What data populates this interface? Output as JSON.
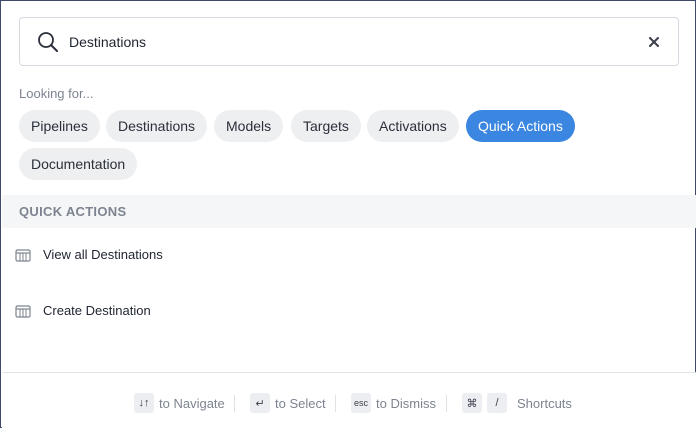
{
  "search": {
    "value": "Destinations",
    "icon": "search-icon",
    "clear_icon": "close-icon"
  },
  "looking_for": {
    "label": "Looking for...",
    "chips": [
      {
        "label": "Pipelines",
        "active": false
      },
      {
        "label": "Destinations",
        "active": false
      },
      {
        "label": "Models",
        "active": false
      },
      {
        "label": "Targets",
        "active": false
      },
      {
        "label": "Activations",
        "active": false
      },
      {
        "label": "Quick Actions",
        "active": true
      },
      {
        "label": "Documentation",
        "active": false
      }
    ]
  },
  "section": {
    "title": "QUICK ACTIONS",
    "items": [
      {
        "label": "View all Destinations",
        "icon": "destination-icon"
      },
      {
        "label": "Create Destination",
        "icon": "destination-icon"
      }
    ]
  },
  "footer": {
    "navigate": {
      "key": "↓↑",
      "label": "to Navigate"
    },
    "select": {
      "key": "↵",
      "label": "to Select"
    },
    "dismiss": {
      "key": "esc",
      "label": "to Dismiss"
    },
    "shortcuts": {
      "key1": "⌘",
      "key2": "/",
      "label": "Shortcuts"
    }
  },
  "colors": {
    "accent": "#3b86e0",
    "border": "#3f4a6b",
    "chip_bg": "#eeeff1",
    "muted_text": "#7d8490"
  }
}
